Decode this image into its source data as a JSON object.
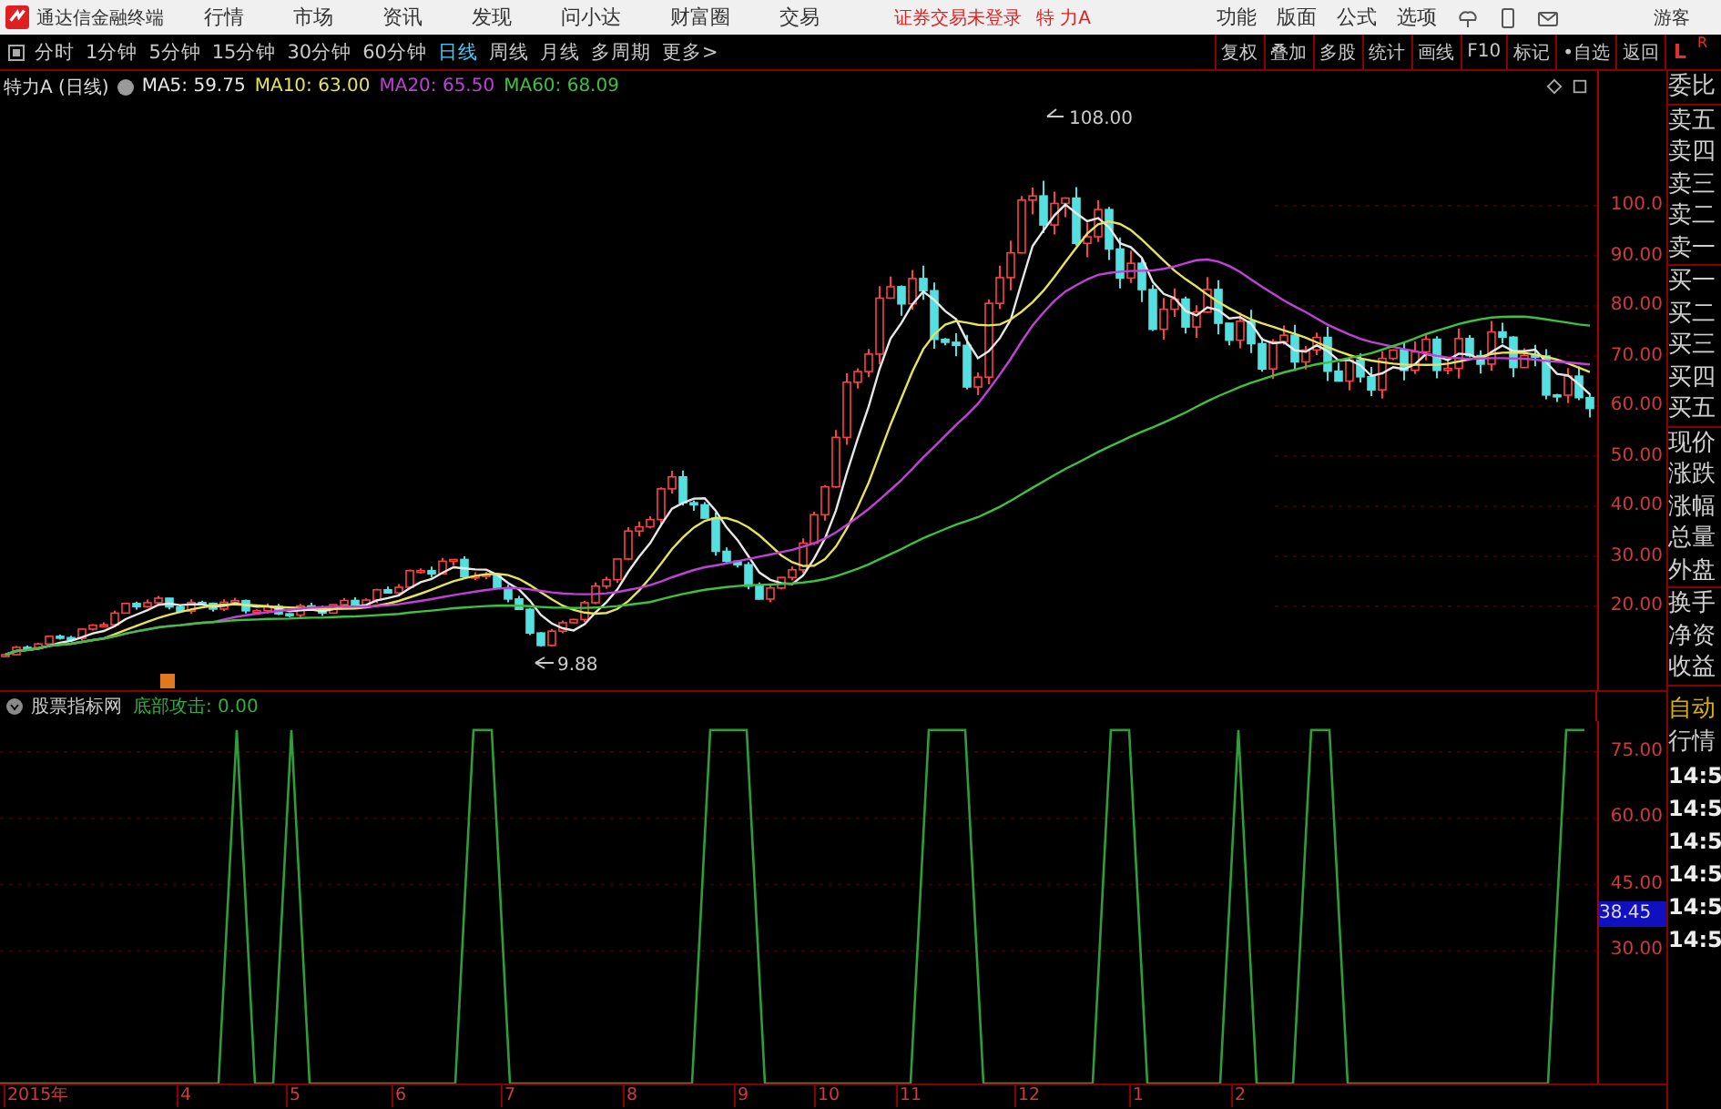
{
  "app_title": "通达信金融终端",
  "menu": [
    "行情",
    "市场",
    "资讯",
    "发现",
    "问小达",
    "财富圈",
    "交易"
  ],
  "login_status": "证券交易未登录",
  "stock_name": "特 力A",
  "top_actions": [
    "功能",
    "版面",
    "公式",
    "选项"
  ],
  "user": "游客",
  "periods": [
    {
      "label": "分时",
      "selected": false
    },
    {
      "label": "1分钟",
      "selected": false
    },
    {
      "label": "5分钟",
      "selected": false
    },
    {
      "label": "15分钟",
      "selected": false
    },
    {
      "label": "30分钟",
      "selected": false
    },
    {
      "label": "60分钟",
      "selected": false
    },
    {
      "label": "日线",
      "selected": true
    },
    {
      "label": "周线",
      "selected": false
    },
    {
      "label": "月线",
      "selected": false
    },
    {
      "label": "多周期",
      "selected": false
    },
    {
      "label": "更多>",
      "selected": false
    }
  ],
  "chart_tools": [
    "复权",
    "叠加",
    "多股",
    "统计",
    "画线",
    "F10",
    "标记",
    "•自选",
    "返回"
  ],
  "corner": [
    "L",
    "R"
  ],
  "main_chart": {
    "title": "特力A (日线)",
    "ma": [
      {
        "label": "MA5: 59.75",
        "color": "#e8e8e8"
      },
      {
        "label": "MA10: 63.00",
        "color": "#e6e35a"
      },
      {
        "label": "MA20: 65.50",
        "color": "#c040d8"
      },
      {
        "label": "MA60: 68.09",
        "color": "#40c040"
      }
    ],
    "high_label": "108.00",
    "low_label": "9.88",
    "y_axis": [
      "100.0",
      "90.00",
      "80.00",
      "70.00",
      "60.00",
      "50.00",
      "40.00",
      "30.00",
      "20.00"
    ]
  },
  "indicator": {
    "name": "股票指标网",
    "reading": "底部攻击: 0.00",
    "current_value": "38.45",
    "chart_data": {
      "type": "line",
      "ylim": [
        0,
        82
      ],
      "grid": true,
      "yticks": [
        {
          "value": 75,
          "label": "75.00"
        },
        {
          "value": 60,
          "label": "60.00"
        },
        {
          "value": 45,
          "label": "45.00"
        },
        {
          "value": 30,
          "label": "30.00"
        }
      ],
      "series": [
        {
          "color": "#2f9e3a",
          "values": [
            0,
            0,
            0,
            0,
            0,
            0,
            0,
            0,
            0,
            0,
            0,
            0,
            0,
            80,
            0,
            0,
            80,
            0,
            0,
            0,
            0,
            0,
            0,
            0,
            0,
            0,
            80,
            80,
            0,
            0,
            0,
            0,
            0,
            0,
            0,
            0,
            0,
            0,
            0,
            80,
            80,
            80,
            0,
            0,
            0,
            0,
            0,
            0,
            0,
            0,
            0,
            80,
            80,
            80,
            0,
            0,
            0,
            0,
            0,
            0,
            0,
            80,
            80,
            0,
            0,
            0,
            0,
            0,
            80,
            0,
            0,
            0,
            80,
            80,
            0,
            0,
            0,
            0,
            0,
            0,
            0,
            0,
            0,
            0,
            0,
            0,
            80,
            80
          ]
        }
      ]
    }
  },
  "x_axis": [
    "2015年",
    "4",
    "5",
    "6",
    "7",
    "8",
    "9",
    "10",
    "11",
    "12",
    "1",
    "2"
  ],
  "quote_groups": [
    [
      "委比"
    ],
    [
      "卖五",
      "卖四",
      "卖三",
      "卖二",
      "卖一"
    ],
    [
      "买一",
      "买二",
      "买三",
      "买四",
      "买五"
    ],
    [
      "现价",
      "涨跌",
      "涨幅",
      "总量",
      "外盘"
    ],
    [
      "换手",
      "净资",
      "收益"
    ]
  ],
  "quote_modes": [
    "自动",
    "行情"
  ],
  "times": [
    "14:5",
    "14:5",
    "14:5",
    "14:5",
    "14:5",
    "14:5"
  ]
}
